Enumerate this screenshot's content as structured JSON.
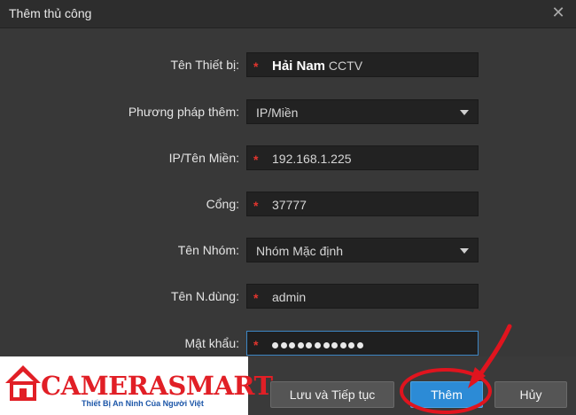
{
  "dialog": {
    "title": "Thêm thủ công"
  },
  "form": {
    "device_name": {
      "label": "Tên Thiết bị:",
      "required_mark": "*",
      "value_bold": "Hải Nam",
      "value_rest": "CCTV"
    },
    "method": {
      "label": "Phương pháp thêm:",
      "value": "IP/Miền"
    },
    "ip": {
      "label": "IP/Tên Miền:",
      "required_mark": "*",
      "value": "192.168.1.225"
    },
    "port": {
      "label": "Cổng:",
      "required_mark": "*",
      "value": "37777"
    },
    "group": {
      "label": "Tên Nhóm:",
      "value": "Nhóm Mặc định"
    },
    "username": {
      "label": "Tên N.dùng:",
      "required_mark": "*",
      "value": "admin"
    },
    "password": {
      "label": "Mật khẩu:",
      "required_mark": "*",
      "masked_length": 11
    }
  },
  "buttons": {
    "save_continue": "Lưu và Tiếp tục",
    "add": "Thêm",
    "cancel": "Hủy"
  },
  "watermark": {
    "brand": "CAMERASMART",
    "tagline": "Thiết Bị An Ninh Của Người Việt"
  },
  "colors": {
    "accent": "#2c8bd6",
    "required": "#e2352e",
    "annotation": "#e0141e",
    "brand": "#e11f26"
  },
  "icons": {
    "close": "close-icon",
    "dropdown": "chevron-down-icon",
    "logo": "house-logo-icon"
  }
}
